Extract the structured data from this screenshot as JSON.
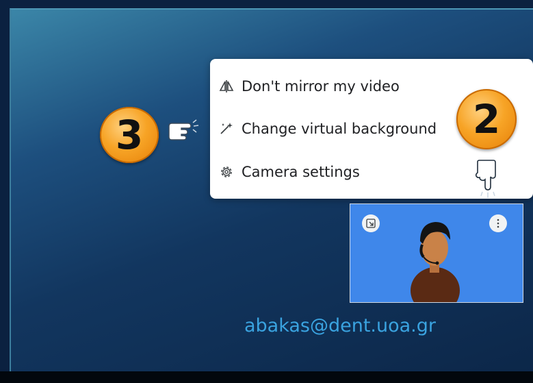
{
  "menu": {
    "items": [
      {
        "label": "Don't mirror my video",
        "icon": "mirror-icon"
      },
      {
        "label": "Change virtual background",
        "icon": "magic-wand-icon"
      },
      {
        "label": "Camera settings",
        "icon": "gear-icon"
      }
    ]
  },
  "badges": {
    "step_a": "3",
    "step_b": "2"
  },
  "preview": {
    "left_button_icon": "pip-icon",
    "right_button_icon": "more-vert-icon"
  },
  "footer": {
    "email": "abakas@dent.uoa.gr"
  },
  "colors": {
    "slide_dark": "#0c2749",
    "slide_light": "#3b86a8",
    "badge_orange": "#f7a426",
    "email_blue": "#3aa3e0",
    "preview_blue": "#3f87ea"
  }
}
